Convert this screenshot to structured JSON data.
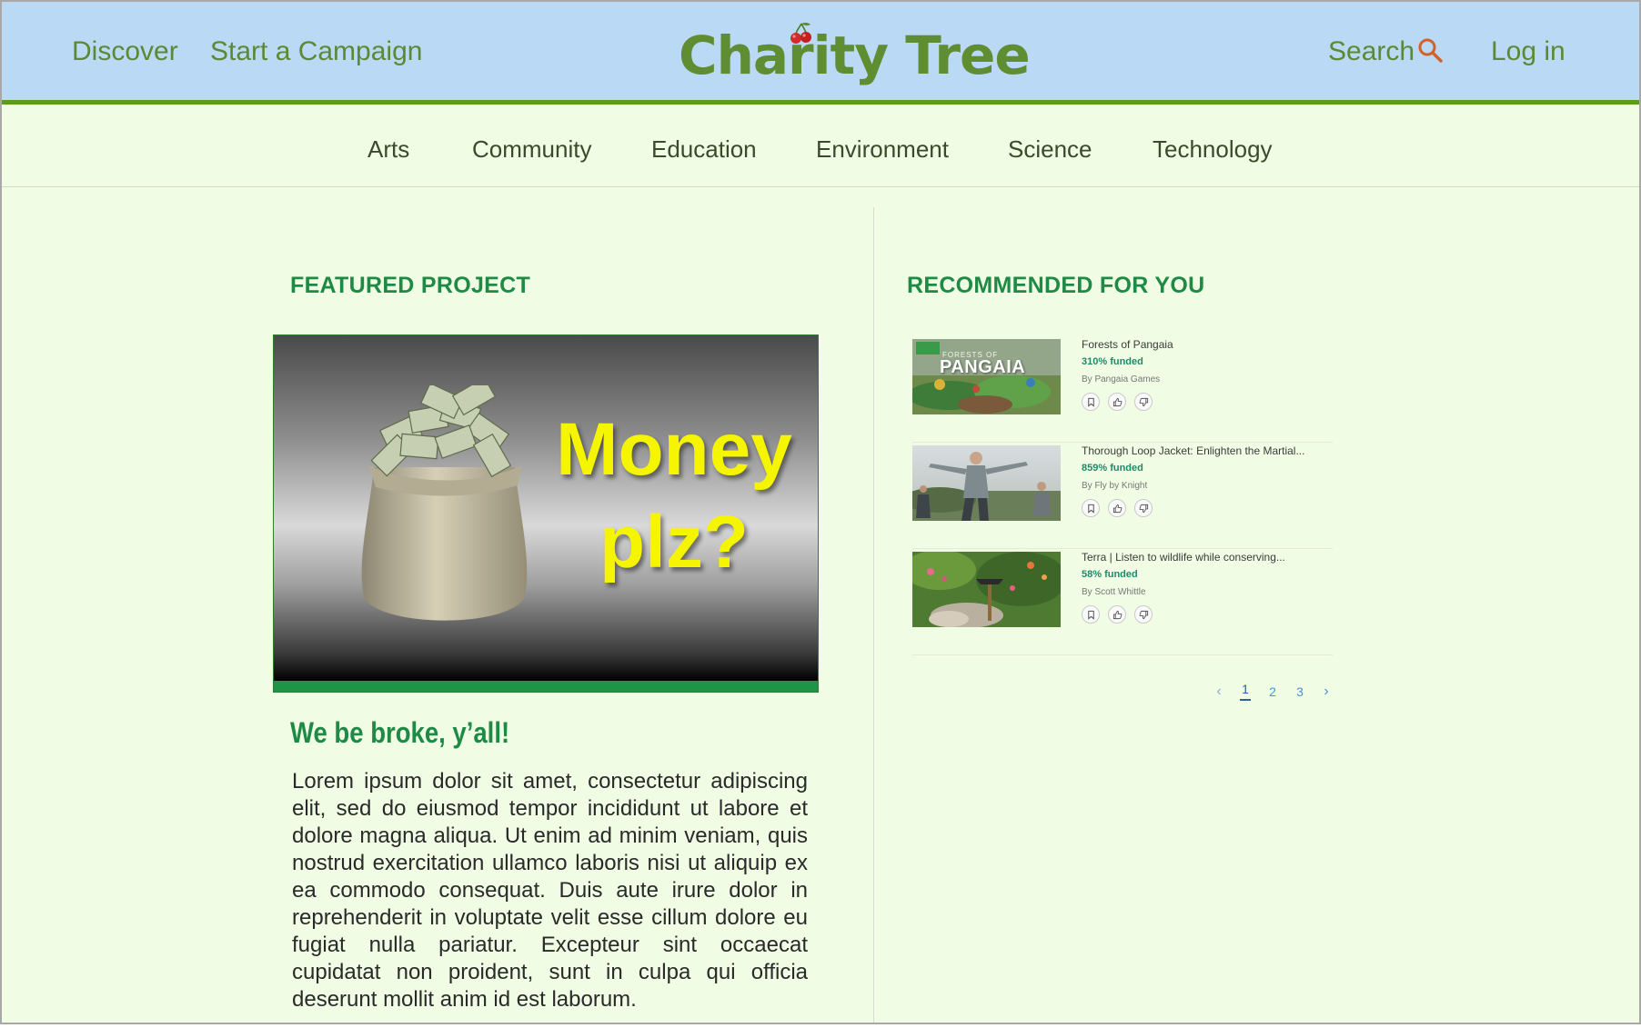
{
  "header": {
    "nav_discover": "Discover",
    "nav_start": "Start a Campaign",
    "logo": "Charity Tree",
    "search": "Search",
    "login": "Log in"
  },
  "categories": [
    "Arts",
    "Community",
    "Education",
    "Environment",
    "Science",
    "Technology"
  ],
  "featured": {
    "heading": "FEATURED PROJECT",
    "image_line1": "Money",
    "image_line2": "plz?",
    "title": "We be broke, y’all!",
    "description": "Lorem ipsum dolor sit amet, consectetur adipiscing elit, sed do eiusmod tempor incididunt ut labore et dolore magna aliqua. Ut enim ad minim veniam, quis nostrud exercitation ullamco laboris nisi ut aliquip ex ea commodo consequat. Duis aute irure dolor in reprehenderit in voluptate velit esse cillum dolore eu fugiat nulla pariatur. Excepteur sint occaecat cupidatat non proident, sunt in culpa qui officia deserunt mollit anim id est laborum."
  },
  "recommended": {
    "heading": "RECOMMENDED FOR YOU",
    "items": [
      {
        "title": "Forests of Pangaia",
        "funded": "310% funded",
        "by": "By Pangaia Games",
        "thumb_text": "PANGAIA",
        "thumb_subtext": "FORESTS OF"
      },
      {
        "title": "Thorough Loop Jacket: Enlighten the Martial...",
        "funded": "859% funded",
        "by": "By Fly by Knight"
      },
      {
        "title": "Terra | Listen to wildlife while conserving...",
        "funded": "58% funded",
        "by": "By Scott Whittle"
      }
    ]
  },
  "pager": {
    "prev": "‹",
    "pages": [
      "1",
      "2",
      "3"
    ],
    "current": "1",
    "next": "›"
  },
  "colors": {
    "header_bg": "#bad9f4",
    "accent_green": "#5d9b1c",
    "heading_green": "#1e8a45",
    "page_bg": "#f0fde4"
  }
}
